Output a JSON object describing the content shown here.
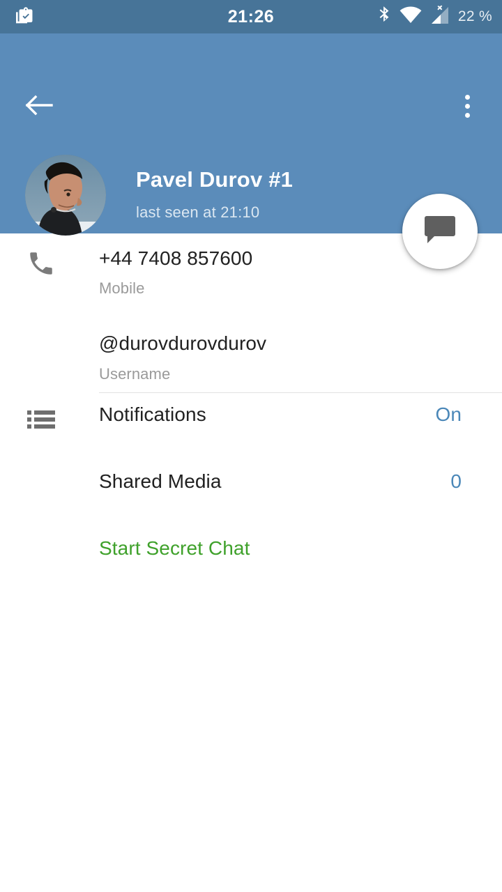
{
  "status_bar": {
    "clock": "21:26",
    "battery": "22 %",
    "icons": {
      "left": "clipboard-check-icon",
      "bluetooth": "bluetooth-icon",
      "wifi": "wifi-icon",
      "cellular": "cellular-no-signal-icon"
    },
    "background": "#477498"
  },
  "header": {
    "background": "#5b8cba",
    "back_icon": "back-arrow-icon",
    "menu_icon": "overflow-menu-icon",
    "avatar_alt": "contact-photo",
    "name": "Pavel Durov #1",
    "status": "last seen at 21:10",
    "fab_icon": "chat-bubble-icon"
  },
  "info": [
    {
      "icon": "phone-icon",
      "value": "+44 7408 857600",
      "label": "Mobile"
    },
    {
      "icon": "",
      "value": "@durovdurovdurov",
      "label": "Username"
    }
  ],
  "options": {
    "list_icon": "list-icon",
    "notifications": {
      "label": "Notifications",
      "value": "On",
      "value_color": "#4a87b8"
    },
    "shared_media": {
      "label": "Shared Media",
      "value": "0",
      "value_color": "#4a87b8"
    },
    "secret_chat": {
      "label": "Start Secret Chat",
      "color": "#3fa12b"
    }
  }
}
